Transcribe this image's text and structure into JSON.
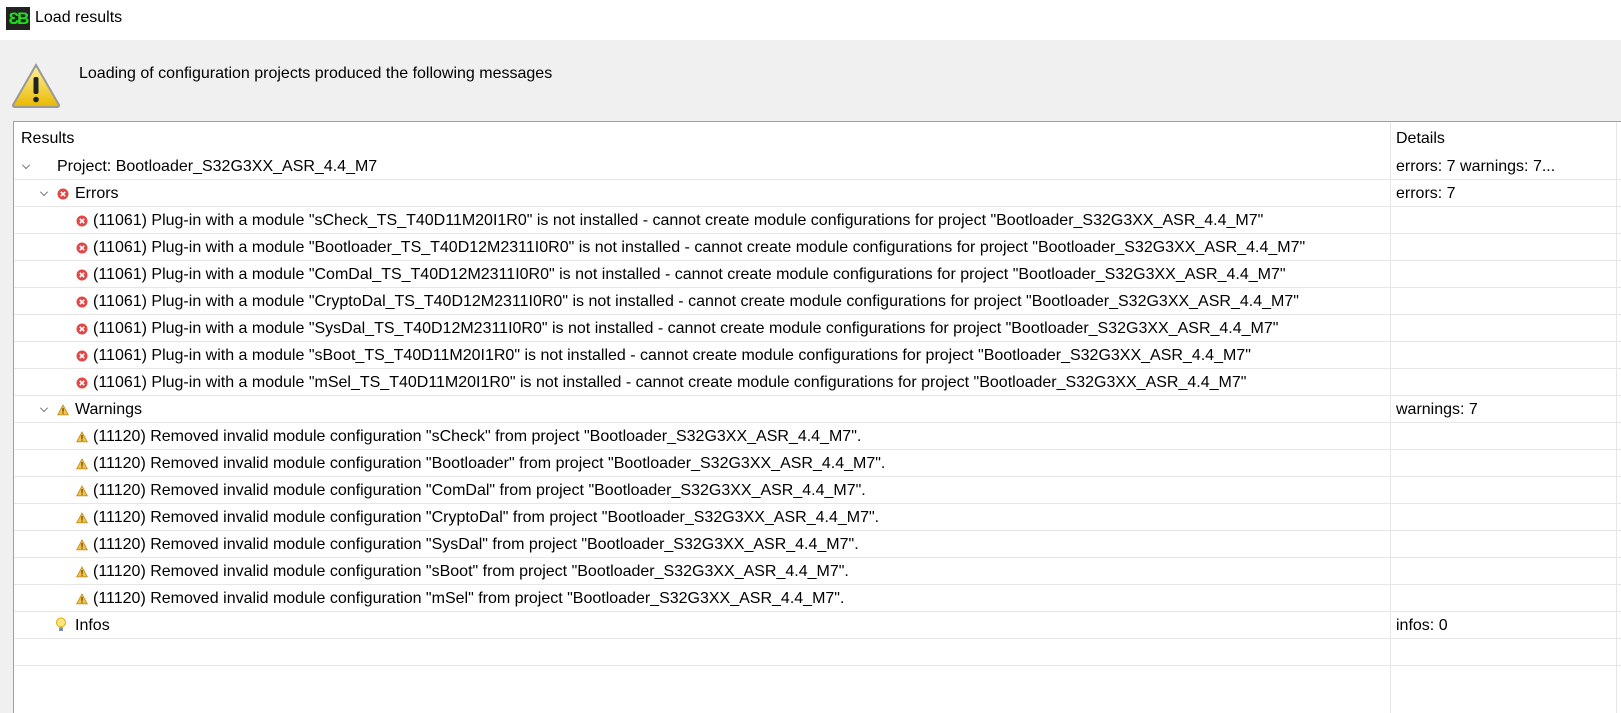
{
  "window": {
    "title": "Load results",
    "logo_text": "EB"
  },
  "header": {
    "message": "Loading of configuration projects produced the following messages"
  },
  "columns": {
    "results": "Results",
    "details": "Details"
  },
  "project": {
    "label": "Project: Bootloader_S32G3XX_ASR_4.4_M7",
    "details": "errors: 7 warnings: 7..."
  },
  "errors": {
    "label": "Errors",
    "details": "errors: 7",
    "items": [
      "(11061) Plug-in with a module \"sCheck_TS_T40D11M20I1R0\" is not installed - cannot create module configurations for project \"Bootloader_S32G3XX_ASR_4.4_M7\"",
      "(11061) Plug-in with a module \"Bootloader_TS_T40D12M2311I0R0\" is not installed - cannot create module configurations for project \"Bootloader_S32G3XX_ASR_4.4_M7\"",
      "(11061) Plug-in with a module \"ComDal_TS_T40D12M2311I0R0\" is not installed - cannot create module configurations for project \"Bootloader_S32G3XX_ASR_4.4_M7\"",
      "(11061) Plug-in with a module \"CryptoDal_TS_T40D12M2311I0R0\" is not installed - cannot create module configurations for project \"Bootloader_S32G3XX_ASR_4.4_M7\"",
      "(11061) Plug-in with a module \"SysDal_TS_T40D12M2311I0R0\" is not installed - cannot create module configurations for project \"Bootloader_S32G3XX_ASR_4.4_M7\"",
      "(11061) Plug-in with a module \"sBoot_TS_T40D11M20I1R0\" is not installed - cannot create module configurations for project \"Bootloader_S32G3XX_ASR_4.4_M7\"",
      "(11061) Plug-in with a module \"mSel_TS_T40D11M20I1R0\" is not installed - cannot create module configurations for project \"Bootloader_S32G3XX_ASR_4.4_M7\""
    ]
  },
  "warnings": {
    "label": "Warnings",
    "details": "warnings: 7",
    "items": [
      "(11120) Removed invalid module configuration \"sCheck\" from project \"Bootloader_S32G3XX_ASR_4.4_M7\".",
      "(11120) Removed invalid module configuration \"Bootloader\" from project \"Bootloader_S32G3XX_ASR_4.4_M7\".",
      "(11120) Removed invalid module configuration \"ComDal\" from project \"Bootloader_S32G3XX_ASR_4.4_M7\".",
      "(11120) Removed invalid module configuration \"CryptoDal\" from project \"Bootloader_S32G3XX_ASR_4.4_M7\".",
      "(11120) Removed invalid module configuration \"SysDal\" from project \"Bootloader_S32G3XX_ASR_4.4_M7\".",
      "(11120) Removed invalid module configuration \"sBoot\" from project \"Bootloader_S32G3XX_ASR_4.4_M7\".",
      "(11120) Removed invalid module configuration \"mSel\" from project \"Bootloader_S32G3XX_ASR_4.4_M7\"."
    ]
  },
  "infos": {
    "label": "Infos",
    "details": "infos: 0"
  }
}
